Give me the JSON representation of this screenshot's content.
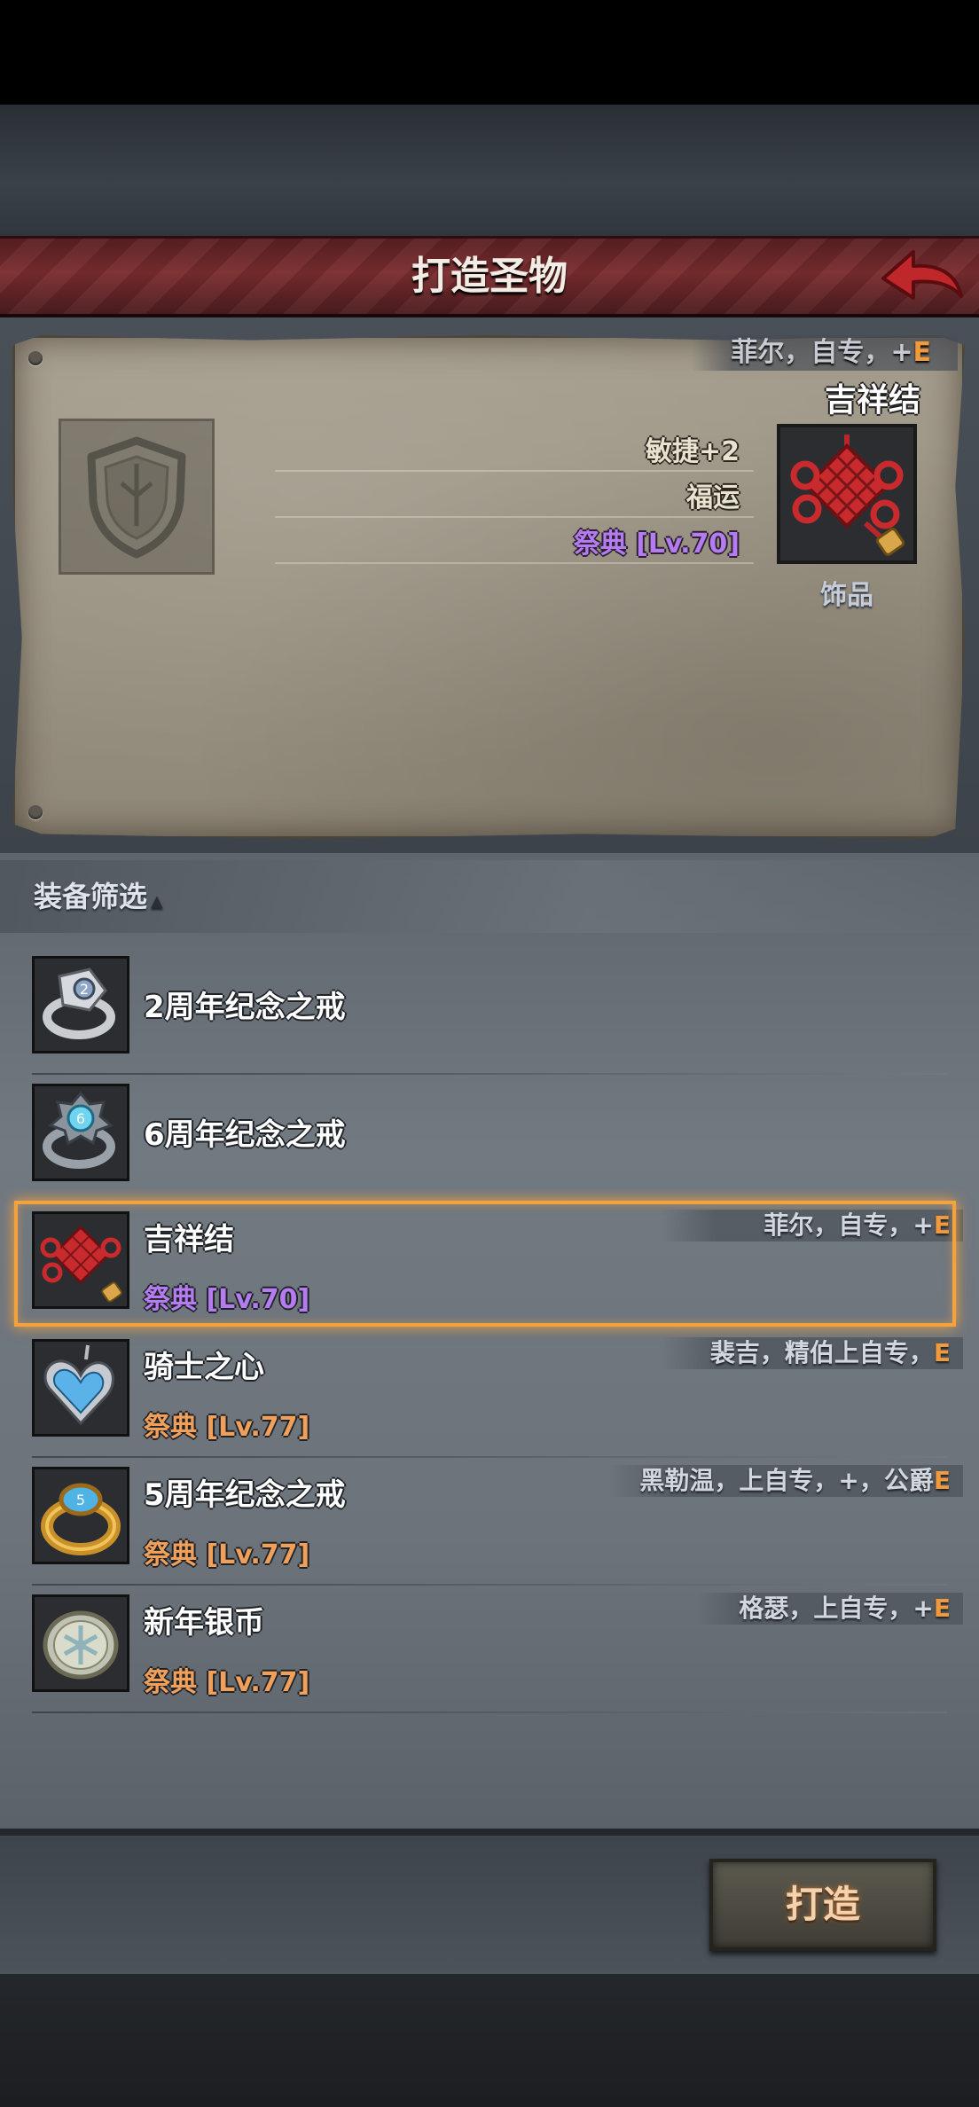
{
  "header": {
    "title": "打造圣物"
  },
  "detail": {
    "tags_prefix": "菲尔，自专，+",
    "tags_grade": "E",
    "name": "吉祥结",
    "stats": [
      "敏捷+2",
      "福运"
    ],
    "type_line": "祭典 [Lv.70]",
    "category": "饰品"
  },
  "filter": {
    "label": "装备筛选"
  },
  "items": [
    {
      "name": "2周年纪念之戒",
      "rarity": "",
      "tags_prefix": "",
      "tags_grade": "",
      "icon": "silver-ring-icon"
    },
    {
      "name": "6周年纪念之戒",
      "rarity": "",
      "tags_prefix": "",
      "tags_grade": "",
      "icon": "blue-gem-ring-icon"
    },
    {
      "name": "吉祥结",
      "rarity": "祭典 [Lv.70]",
      "tags_prefix": "菲尔，自专，+",
      "tags_grade": "E",
      "icon": "chinese-knot-icon"
    },
    {
      "name": "骑士之心",
      "rarity": "祭典 [Lv.77]",
      "tags_prefix": "裴吉，精伯上自专，",
      "tags_grade": "E",
      "icon": "heart-pendant-icon"
    },
    {
      "name": "5周年纪念之戒",
      "rarity": "祭典 [Lv.77]",
      "tags_prefix": "黑勒温，上自专，+，公爵",
      "tags_grade": "E",
      "icon": "gold-ring-icon"
    },
    {
      "name": "新年银币",
      "rarity": "祭典 [Lv.77]",
      "tags_prefix": "格瑟，上自专，+",
      "tags_grade": "E",
      "icon": "silver-coin-icon"
    }
  ],
  "actions": {
    "forge_label": "打造"
  },
  "colors": {
    "purple_rarity": "#b47cf0",
    "orange_rarity": "#f0a05a",
    "grade_e": "#f09a3c",
    "selection": "#f2a23e"
  }
}
